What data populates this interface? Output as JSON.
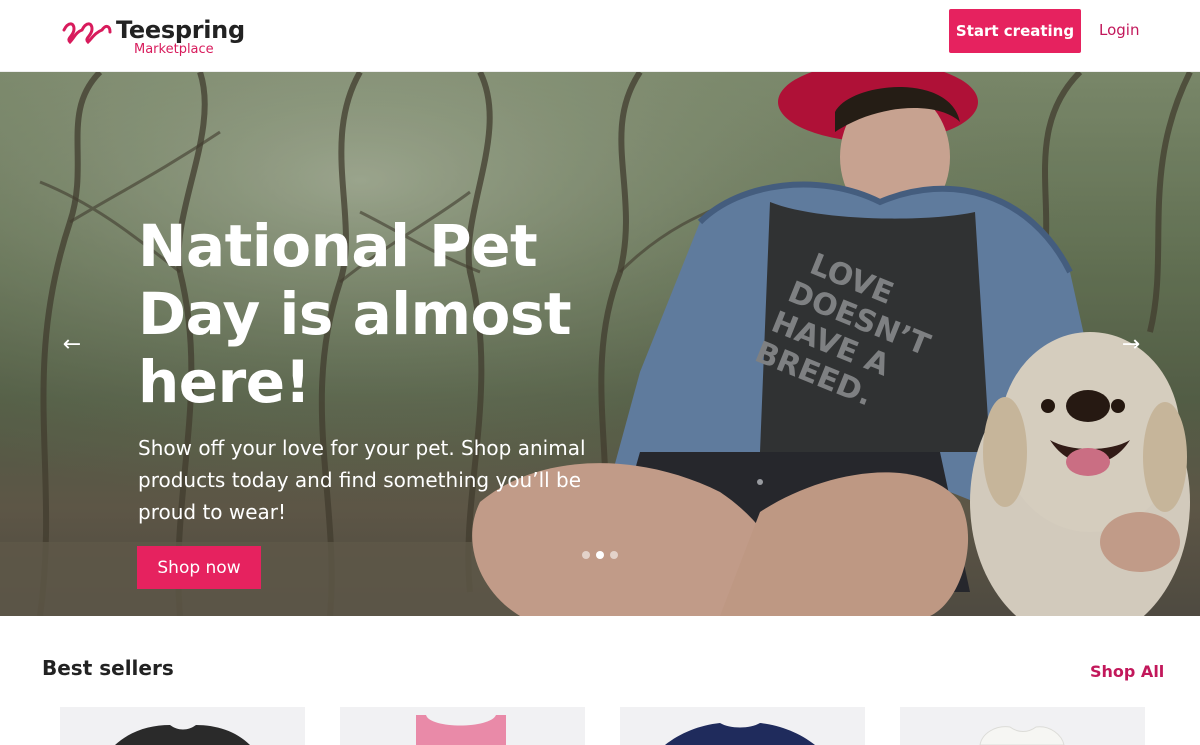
{
  "header": {
    "logo_name": "Teespring",
    "logo_sub": "Marketplace",
    "start_label": "Start creating",
    "login_label": "Login"
  },
  "hero": {
    "title": "National Pet Day is almost here!",
    "text": "Show off your love for your pet. Shop animal products today and find something you’ll be proud to wear!",
    "cta_label": "Shop now",
    "prev_icon": "←",
    "next_icon": "→",
    "shirt_text": "LOVE DOESN’T HAVE A BREED.",
    "slides": 3,
    "active_slide": 2
  },
  "best_sellers": {
    "title": "Best sellers",
    "shop_all_label": "Shop All",
    "products": [
      {
        "icon": "black-tshirt-icon",
        "color": "#2a2a2a"
      },
      {
        "icon": "pink-tank-top-icon",
        "color": "#e98aa8"
      },
      {
        "icon": "navy-tshirt-icon",
        "color": "#1f2b5c"
      },
      {
        "icon": "white-hoodie-icon",
        "color": "#f2f2ee"
      }
    ]
  },
  "colors": {
    "accent": "#e6225f",
    "link": "#c2185b"
  }
}
